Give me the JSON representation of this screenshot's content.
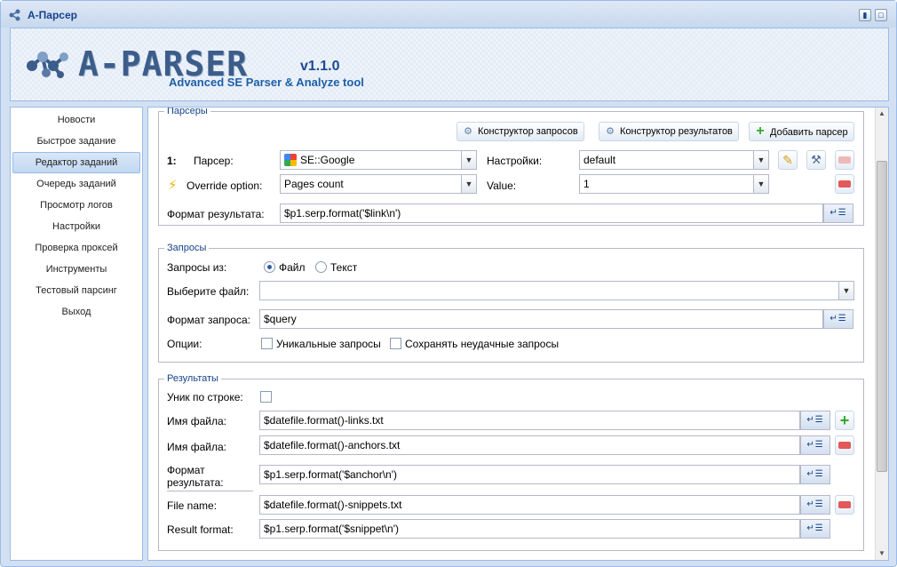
{
  "window": {
    "title": "A-Парсер"
  },
  "header": {
    "logo_text": "A-PARSER",
    "version": "v1.1.0",
    "tagline": "Advanced SE Parser & Analyze tool"
  },
  "sidebar": {
    "items": [
      {
        "label": "Новости",
        "active": false
      },
      {
        "label": "Быстрое задание",
        "active": false
      },
      {
        "label": "Редактор заданий",
        "active": true
      },
      {
        "label": "Очередь заданий",
        "active": false
      },
      {
        "label": "Просмотр логов",
        "active": false
      },
      {
        "label": "Настройки",
        "active": false
      },
      {
        "label": "Проверка проксей",
        "active": false
      },
      {
        "label": "Инструменты",
        "active": false
      },
      {
        "label": "Тестовый парсинг",
        "active": false
      },
      {
        "label": "Выход",
        "active": false
      }
    ]
  },
  "parsers": {
    "legend": "Парсеры",
    "btn_query_builder": "Конструктор запросов",
    "btn_result_builder": "Конструктор результатов",
    "btn_add_parser": "Добавить парсер",
    "row_index": "1:",
    "parser_label": "Парсер:",
    "parser_value": "SE::Google",
    "settings_label": "Настройки:",
    "settings_value": "default",
    "override_label": "Override option:",
    "override_value": "Pages count",
    "value_label": "Value:",
    "value_value": "1",
    "result_format_label": "Формат результата:",
    "result_format_value": "$p1.serp.format('$link\\n')"
  },
  "queries": {
    "legend": "Запросы",
    "source_label": "Запросы из:",
    "source_options": [
      "Файл",
      "Текст"
    ],
    "source_selected": "Файл",
    "file_label": "Выберите файл:",
    "file_value": "",
    "format_label": "Формат запроса:",
    "format_value": "$query",
    "options_label": "Опции:",
    "opt_unique": "Уникальные запросы",
    "opt_save_failed": "Сохранять неудачные запросы"
  },
  "results": {
    "legend": "Результаты",
    "unique_label": "Уник по строке:",
    "rows": [
      {
        "label": "Имя файла:",
        "value": "$datefile.format()-links.txt"
      },
      {
        "label": "Имя файла:",
        "value": "$datefile.format()-anchors.txt"
      },
      {
        "label": "Формат результата:",
        "value": "$p1.serp.format('$anchor\\n')"
      },
      {
        "label": "File name:",
        "value": "$datefile.format()-snippets.txt"
      },
      {
        "label": "Result format:",
        "value": "$p1.serp.format('$snippet\\n')"
      }
    ]
  },
  "icons": {
    "insert": "return-icon",
    "list": "list-icon",
    "edit": "pencil-icon",
    "tools": "wrench-icon"
  },
  "colors": {
    "accent": "#15428b",
    "border": "#99bbe8",
    "remove": "#e35858",
    "add": "#2ea82e"
  }
}
